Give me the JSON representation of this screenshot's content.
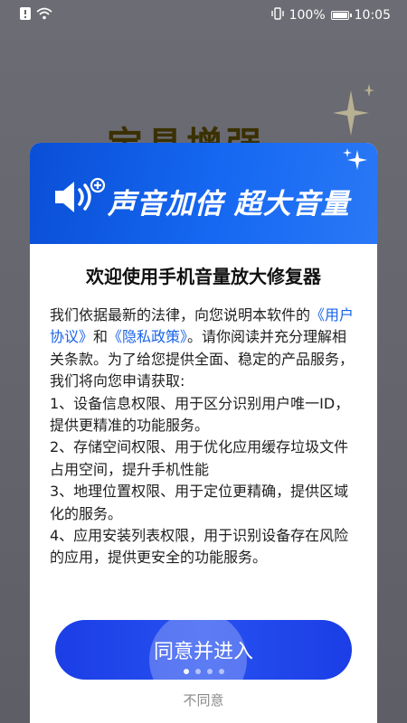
{
  "status_bar": {
    "battery_percent": "100%",
    "time": "10:05"
  },
  "background": {
    "title_fragment": "宝具增强"
  },
  "banner": {
    "text": "声音加倍 超大音量",
    "icon": "speaker-plus-icon"
  },
  "dialog": {
    "title": "欢迎使用手机音量放大修复器",
    "intro_prefix": "我们依据最新的法律，向您说明本软件的",
    "user_agreement_link": "《用户协议》",
    "and_text": "和",
    "privacy_policy_link": "《隐私政策》",
    "intro_suffix": "。请你阅读并充分理解相关条款。为了给您提供全面、稳定的产品服务，我们将向您申请获取:",
    "items": [
      "1、设备信息权限、用于区分识别用户唯一ID，提供更精准的功能服务。",
      "2、存储空间权限、用于优化应用缓存垃圾文件占用空间，提升手机性能",
      "3、地理位置权限、用于定位更精确，提供区域化的服务。",
      "4、应用安装列表权限，用于识别设备存在风险的应用，提供更安全的功能服务。"
    ],
    "agree_label": "同意并进入",
    "decline_label": "不同意"
  },
  "colors": {
    "banner_blue": "#1668f2",
    "button_blue": "#2650f0",
    "link_blue": "#1a64e8"
  }
}
